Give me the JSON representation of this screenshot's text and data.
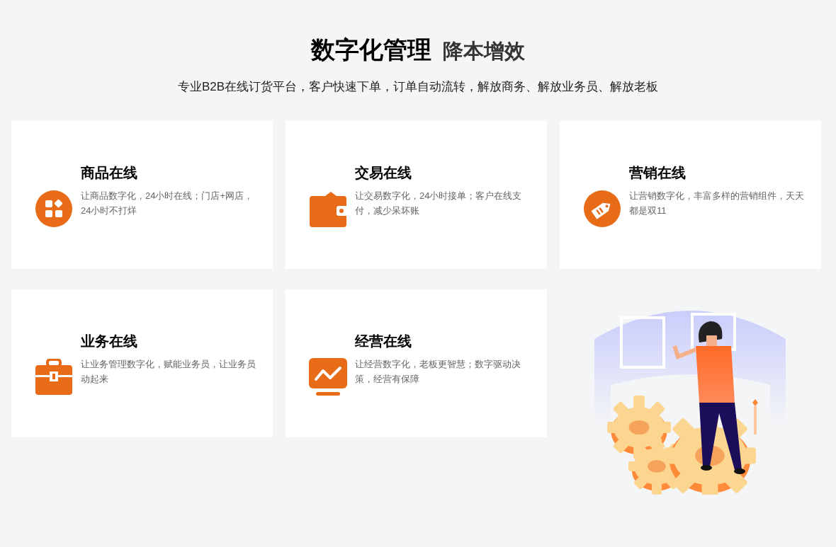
{
  "header": {
    "title": "数字化管理",
    "title_accent": "降本增效",
    "subtitle": "专业B2B在线订货平台，客户快速下单，订单自动流转，解放商务、解放业务员、解放老板"
  },
  "features": [
    {
      "kind": "grid",
      "title": "商品在线",
      "description": "让商品数字化，24小时在线；门店+网店，24小时不打烊"
    },
    {
      "kind": "wallet",
      "title": "交易在线",
      "description": "让交易数字化，24小时接单；客户在线支付，减少呆坏账"
    },
    {
      "kind": "tag",
      "title": "营销在线",
      "description": "让营销数字化，丰富多样的营销组件，天天都是双11"
    },
    {
      "kind": "briefcase",
      "title": "业务在线",
      "description": "让业务管理数字化，赋能业务员，让业务员动起来"
    },
    {
      "kind": "chart",
      "title": "经营在线",
      "description": "让经营数字化，老板更智慧；数字驱动决策，经营有保障"
    }
  ]
}
